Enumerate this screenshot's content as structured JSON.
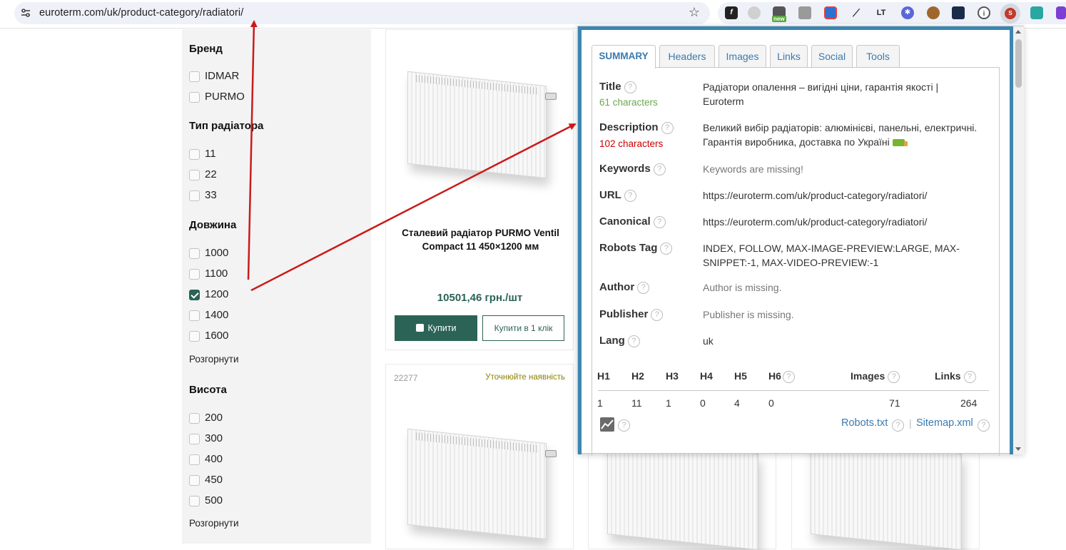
{
  "browser": {
    "url": "euroterm.com/uk/product-category/radiatori/",
    "extension_badge_new": "new"
  },
  "sidebar": {
    "brand_title": "Бренд",
    "brand_items": [
      "IDMAR",
      "PURMO"
    ],
    "type_title": "Тип радіатора",
    "type_items": [
      "11",
      "22",
      "33"
    ],
    "length_title": "Довжина",
    "length_items": [
      {
        "label": "1000",
        "checked": false
      },
      {
        "label": "1100",
        "checked": false
      },
      {
        "label": "1200",
        "checked": true
      },
      {
        "label": "1400",
        "checked": false
      },
      {
        "label": "1600",
        "checked": false
      }
    ],
    "expand_label": "Розгорнути",
    "height_title": "Висота",
    "height_items": [
      "200",
      "300",
      "400",
      "450",
      "500"
    ]
  },
  "product1": {
    "name_line1": "Сталевий радіатор PURMO Ventil",
    "name_line2": "Compact 11 450×1200 мм",
    "price": "10501,46 грн./шт",
    "buy_label": "Купити",
    "one_click_label": "Купити в 1 клік"
  },
  "product2": {
    "sku": "22277",
    "availability": "Уточнюйте наявність"
  },
  "seo": {
    "tabs": [
      "SUMMARY",
      "Headers",
      "Images",
      "Links",
      "Social",
      "Tools"
    ],
    "title_label": "Title",
    "title_count": "61 characters",
    "title_value": "Радіатори опалення – вигідні ціни, гарантія якості | Euroterm",
    "description_label": "Description",
    "description_count": "102 characters",
    "description_value": "Великий вибір радіаторів: алюмінієві, панельні, електричні. Гарантія виробника, доставка по Україні",
    "keywords_label": "Keywords",
    "keywords_value": "Keywords are missing!",
    "url_label": "URL",
    "url_value": "https://euroterm.com/uk/product-category/radiatori/",
    "canonical_label": "Canonical",
    "canonical_value": "https://euroterm.com/uk/product-category/radiatori/",
    "robots_label": "Robots Tag",
    "robots_value": "INDEX, FOLLOW, MAX-IMAGE-PREVIEW:LARGE, MAX-SNIPPET:-1, MAX-VIDEO-PREVIEW:-1",
    "author_label": "Author",
    "author_value": "Author is missing.",
    "publisher_label": "Publisher",
    "publisher_value": "Publisher is missing.",
    "lang_label": "Lang",
    "lang_value": "uk",
    "headings": {
      "h1_label": "H1",
      "h2_label": "H2",
      "h3_label": "H3",
      "h4_label": "H4",
      "h5_label": "H5",
      "h6_label": "H6",
      "images_label": "Images",
      "links_label": "Links",
      "h1": "1",
      "h2": "11",
      "h3": "1",
      "h4": "0",
      "h5": "4",
      "h6": "0",
      "images": "71",
      "links": "264"
    },
    "help_glyph": "?",
    "robots_txt_label": "Robots.txt",
    "sitemap_label": "Sitemap.xml",
    "separator": "|",
    "colors": {
      "good": "#6aa84f",
      "bad": "#cc0000",
      "accent": "#3b86b3"
    }
  }
}
